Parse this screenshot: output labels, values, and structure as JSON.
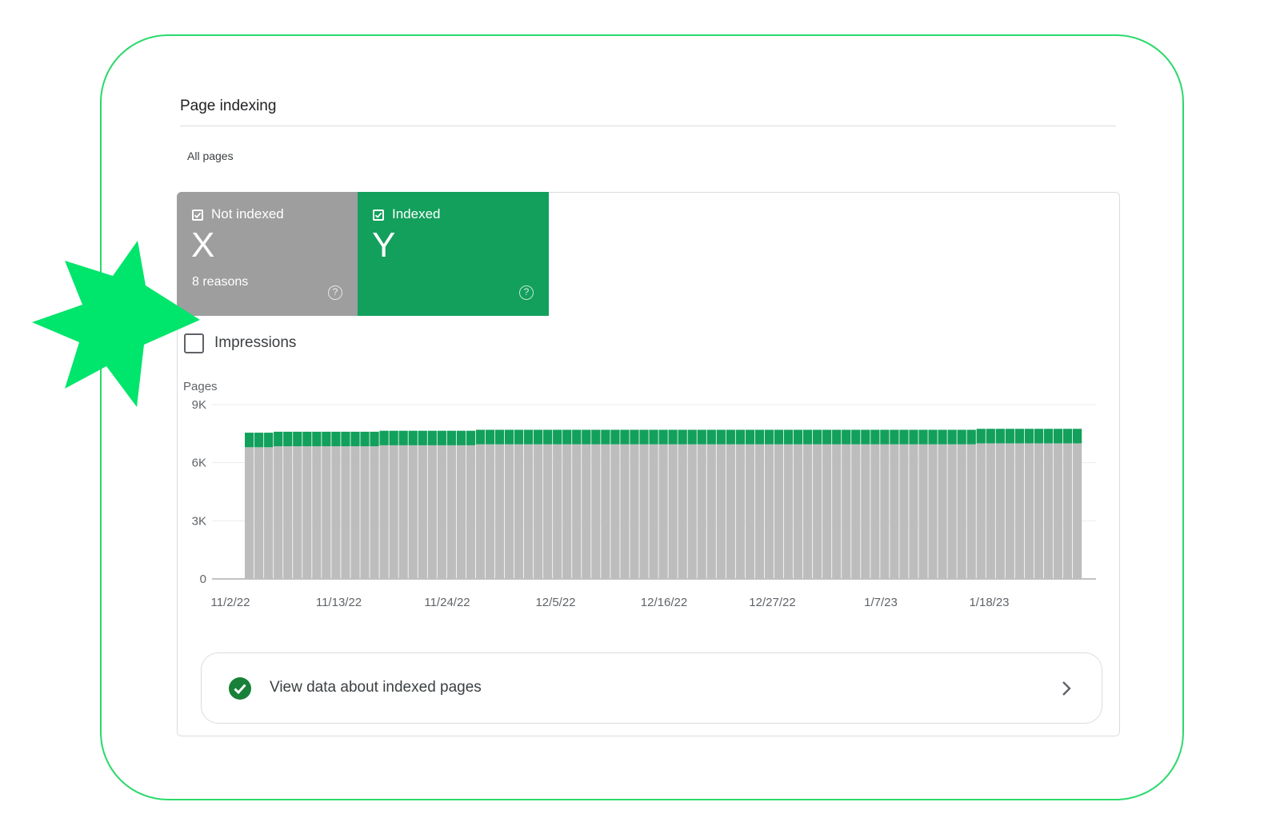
{
  "page": {
    "title": "Page indexing",
    "filter_label": "All pages"
  },
  "tiles": {
    "not_indexed": {
      "label": "Not indexed",
      "value": "X",
      "sub": "8 reasons",
      "color": "#9e9e9e",
      "checked": true,
      "icon": "help-circle-icon"
    },
    "indexed": {
      "label": "Indexed",
      "value": "Y",
      "color": "#12a05c",
      "checked": true,
      "icon": "help-circle-icon"
    }
  },
  "impressions": {
    "label": "Impressions",
    "checked": false
  },
  "chart_data": {
    "type": "bar",
    "stacked": true,
    "ylabel": "Pages",
    "ylim": [
      0,
      9000
    ],
    "yticks": [
      "0",
      "3K",
      "6K",
      "9K"
    ],
    "x_tick_labels": [
      "11/2/22",
      "11/13/22",
      "11/24/22",
      "12/5/22",
      "12/16/22",
      "12/27/22",
      "1/7/23",
      "1/18/23"
    ],
    "x_start": "2022-11-02",
    "grid": true,
    "colors": {
      "not_indexed": "#bdbdbd",
      "indexed": "#12a05c"
    },
    "series": [
      {
        "name": "Not indexed",
        "values": [
          6800,
          6800,
          6800,
          6850,
          6850,
          6850,
          6850,
          6850,
          6850,
          6850,
          6850,
          6850,
          6850,
          6850,
          6900,
          6900,
          6900,
          6900,
          6900,
          6900,
          6900,
          6900,
          6900,
          6900,
          6950,
          6950,
          6950,
          6950,
          6950,
          6950,
          6950,
          6950,
          6950,
          6950,
          6950,
          6950,
          6950,
          6950,
          6950,
          6950,
          6950,
          6950,
          6950,
          6950,
          6950,
          6950,
          6950,
          6950,
          6950,
          6950,
          6950,
          6950,
          6950,
          6950,
          6950,
          6950,
          6950,
          6950,
          6950,
          6950,
          6950,
          6950,
          6950,
          6950,
          6950,
          6950,
          6950,
          6950,
          6950,
          6950,
          6950,
          6950,
          6950,
          6950,
          6950,
          6950,
          7000,
          7000,
          7000,
          7000,
          7000,
          7000,
          7000,
          7000,
          7000,
          7000,
          7000
        ]
      },
      {
        "name": "Indexed",
        "values": [
          750,
          750,
          750,
          750,
          750,
          750,
          750,
          750,
          750,
          750,
          750,
          750,
          750,
          750,
          750,
          750,
          750,
          750,
          750,
          750,
          750,
          750,
          750,
          750,
          750,
          750,
          750,
          750,
          750,
          750,
          750,
          750,
          750,
          750,
          750,
          750,
          750,
          750,
          750,
          750,
          750,
          750,
          750,
          750,
          750,
          750,
          750,
          750,
          750,
          750,
          750,
          750,
          750,
          750,
          750,
          750,
          750,
          750,
          750,
          750,
          750,
          750,
          750,
          750,
          750,
          750,
          750,
          750,
          750,
          750,
          750,
          750,
          750,
          750,
          750,
          750,
          750,
          750,
          750,
          750,
          750,
          750,
          750,
          750,
          750,
          750,
          750
        ]
      }
    ]
  },
  "footer_link": {
    "label": "View data about indexed pages",
    "icon": "check-circle-icon",
    "chevron": "chevron-right-icon"
  },
  "decoration": {
    "star_color": "#00e56b",
    "frame_color": "#2bd96b"
  }
}
